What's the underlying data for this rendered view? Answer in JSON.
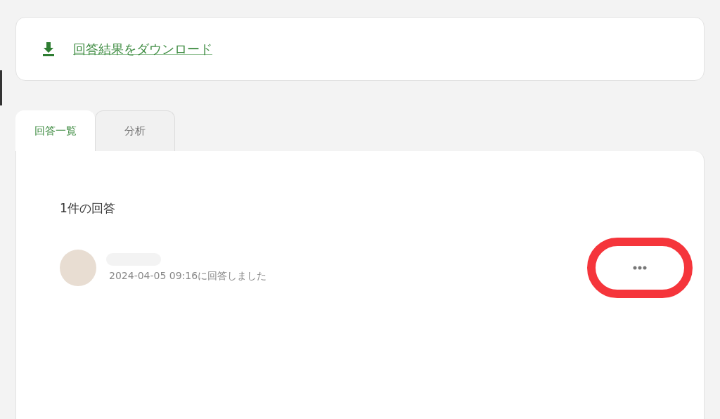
{
  "download_link": {
    "label": "回答結果をダウンロード"
  },
  "tabs": [
    {
      "label": "回答一覧",
      "selected": true
    },
    {
      "label": "分析",
      "selected": false
    }
  ],
  "response_count": "1件の回答",
  "responses": [
    {
      "timestamp": "2024-04-05 09:16に回答しました",
      "highlighted": true
    }
  ]
}
